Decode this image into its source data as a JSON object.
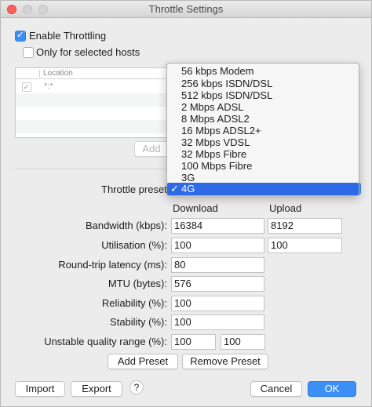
{
  "window": {
    "title": "Throttle Settings"
  },
  "enable_throttling": {
    "label": "Enable Throttling",
    "checked": true
  },
  "only_selected_hosts": {
    "label": "Only for selected hosts",
    "checked": false
  },
  "hosts_table": {
    "column_header": "Location",
    "rows": [
      {
        "checked": true,
        "location": "*:*"
      }
    ],
    "add_label": "Add"
  },
  "preset": {
    "label": "Throttle preset:",
    "selected": "4G",
    "options": [
      "56 kbps Modem",
      "256 kbps ISDN/DSL",
      "512 kbps ISDN/DSL",
      "2 Mbps ADSL",
      "8 Mbps ADSL2",
      "16 Mbps ADSL2+",
      "32 Mbps VDSL",
      "32 Mbps Fibre",
      "100 Mbps Fibre",
      "3G",
      "4G"
    ]
  },
  "columns": {
    "download": "Download",
    "upload": "Upload"
  },
  "fields": {
    "bandwidth": {
      "label": "Bandwidth (kbps):",
      "download": "16384",
      "upload": "8192"
    },
    "utilisation": {
      "label": "Utilisation (%):",
      "download": "100",
      "upload": "100"
    },
    "latency": {
      "label": "Round-trip latency (ms):",
      "value": "80"
    },
    "mtu": {
      "label": "MTU (bytes):",
      "value": "576"
    },
    "reliability": {
      "label": "Reliability (%):",
      "value": "100"
    },
    "stability": {
      "label": "Stability (%):",
      "value": "100"
    },
    "unstable_range": {
      "label": "Unstable quality range (%):",
      "min": "100",
      "max": "100"
    }
  },
  "buttons": {
    "add_preset": "Add Preset",
    "remove_preset": "Remove Preset",
    "import": "Import",
    "export": "Export",
    "help": "?",
    "cancel": "Cancel",
    "ok": "OK"
  },
  "colors": {
    "accent": "#3b8ff5",
    "selection": "#2f6ae6"
  }
}
